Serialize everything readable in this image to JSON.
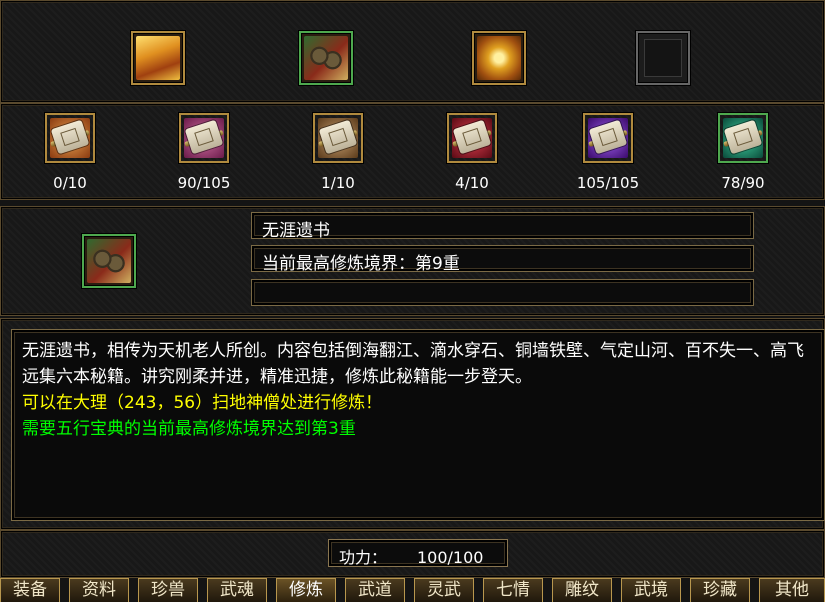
{
  "top_books": [
    {
      "icon": "gold-book-icon"
    },
    {
      "icon": "scroll-bundle-icon",
      "border_color": "#4ea84e"
    },
    {
      "icon": "golden-scrolls-icon"
    },
    {
      "icon": "empty-slot-icon"
    }
  ],
  "scrolls": [
    {
      "icon": "scroll-orange-icon",
      "tint": "#c8782c",
      "progress": "0/10"
    },
    {
      "icon": "scroll-pink-icon",
      "tint": "#b04a7a",
      "progress": "90/105"
    },
    {
      "icon": "scroll-tan-icon",
      "tint": "#9a7a52",
      "progress": "1/10"
    },
    {
      "icon": "scroll-red-icon",
      "tint": "#a82a3a",
      "progress": "4/10"
    },
    {
      "icon": "scroll-purple-icon",
      "tint": "#6a2ab0",
      "progress": "105/105"
    },
    {
      "icon": "scroll-teal-icon",
      "tint": "#1a9a7a",
      "progress": "78/90"
    }
  ],
  "selected_book": {
    "icon": "scroll-bundle-icon",
    "name": "无涯遗书",
    "realm": "当前最高修炼境界：第9重",
    "extra": ""
  },
  "description": {
    "text": "无涯遗书，相传为天机老人所创。内容包括倒海翻江、滴水穿石、铜墙铁壁、气定山河、百不失一、高飞远集六本秘籍。讲究刚柔并进，精准迅捷，修炼此秘籍能一步登天。",
    "location_hint": "可以在大理（243，56）扫地神僧处进行修炼！",
    "requirement": "需要五行宝典的当前最高修炼境界达到第3重",
    "hint_color": "#ffff00",
    "requirement_color": "#00ff00"
  },
  "power": {
    "label": "功力：",
    "value": "100/100"
  },
  "tabs": [
    {
      "label": "装备",
      "active": false
    },
    {
      "label": "资料",
      "active": false
    },
    {
      "label": "珍兽",
      "active": false
    },
    {
      "label": "武魂",
      "active": false
    },
    {
      "label": "修炼",
      "active": true
    },
    {
      "label": "武道",
      "active": false
    },
    {
      "label": "灵武",
      "active": false
    },
    {
      "label": "七情",
      "active": false
    },
    {
      "label": "雕纹",
      "active": false
    },
    {
      "label": "武境",
      "active": false
    },
    {
      "label": "珍藏",
      "active": false
    },
    {
      "label": "其他",
      "active": false
    }
  ]
}
